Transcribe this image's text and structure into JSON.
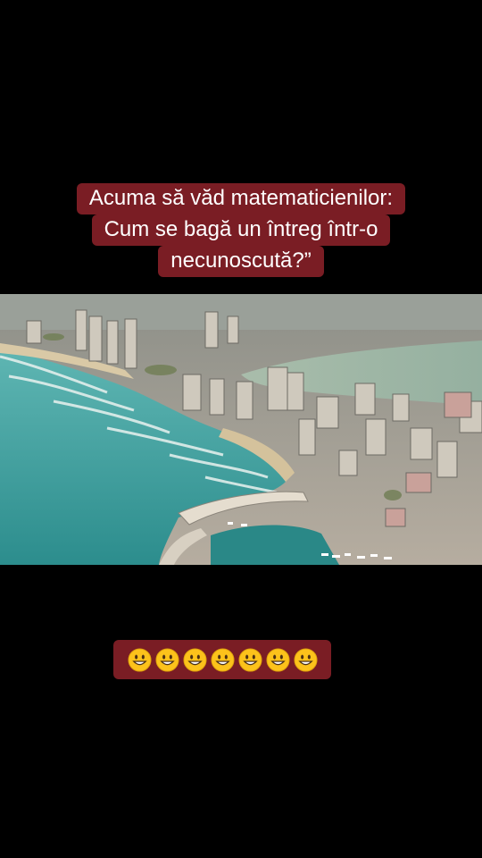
{
  "caption": {
    "line1": "Acuma să văd matematicienilor:",
    "line2": "Cum se bagă un întreg într-o",
    "line3": "necunoscută?”"
  },
  "photo": {
    "subject": "aerial-coastal-city-icon"
  },
  "emoji_bar": {
    "emoji_name": "grinning-face-icon",
    "count": 7
  },
  "colors": {
    "background": "#000000",
    "caption_box": "#7a1d24",
    "caption_text": "#ffffff",
    "sea": "#3a9c9a",
    "lagoon": "#9fb8a4"
  }
}
